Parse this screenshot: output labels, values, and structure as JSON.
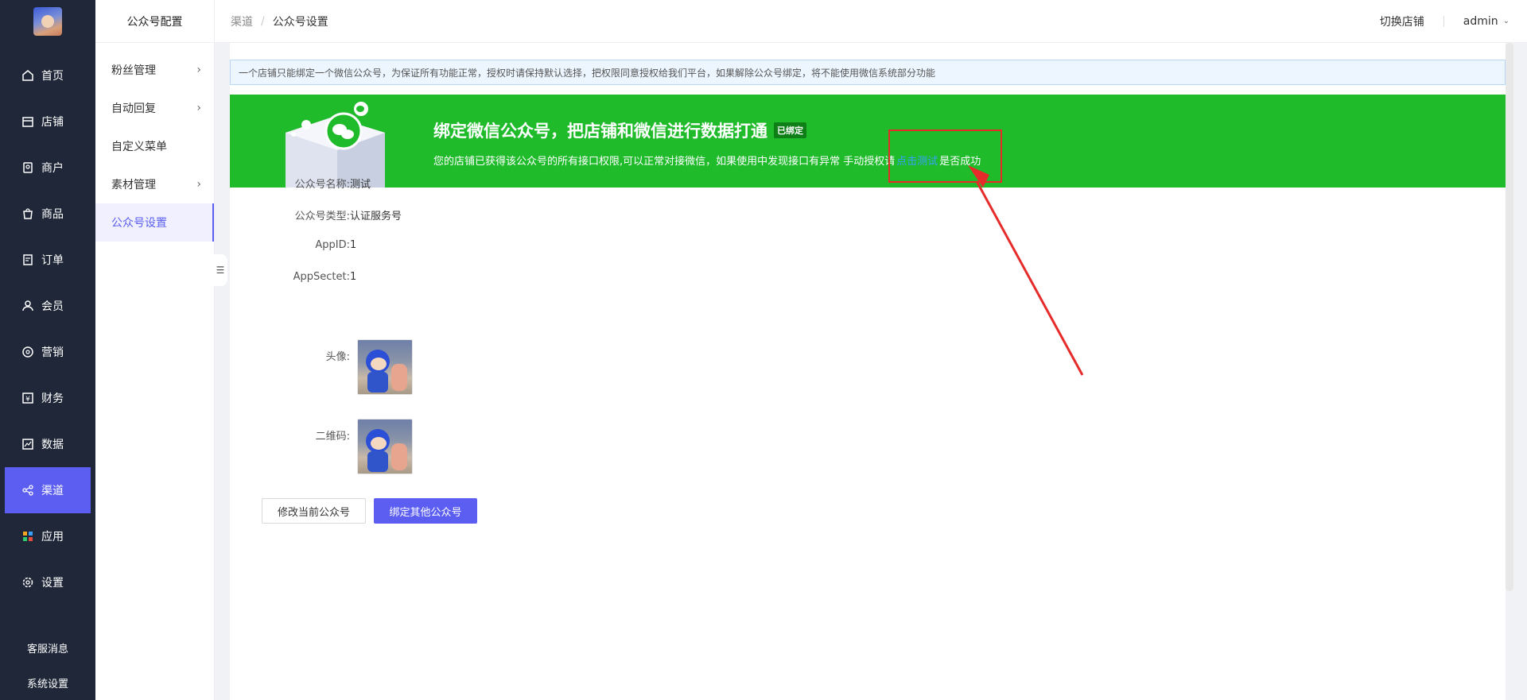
{
  "sidebar": {
    "items": [
      {
        "label": "首页",
        "icon": "home-icon"
      },
      {
        "label": "店铺",
        "icon": "store-icon"
      },
      {
        "label": "商户",
        "icon": "merchant-icon"
      },
      {
        "label": "商品",
        "icon": "bag-icon"
      },
      {
        "label": "订单",
        "icon": "order-icon"
      },
      {
        "label": "会员",
        "icon": "user-icon"
      },
      {
        "label": "营销",
        "icon": "marketing-icon"
      },
      {
        "label": "财务",
        "icon": "yuan-icon"
      },
      {
        "label": "数据",
        "icon": "chart-icon"
      },
      {
        "label": "渠道",
        "icon": "share-icon"
      },
      {
        "label": "应用",
        "icon": "apps-icon"
      },
      {
        "label": "设置",
        "icon": "gear-icon"
      }
    ],
    "active_index": 9,
    "bottom": [
      "客服消息",
      "系统设置"
    ]
  },
  "submenu": {
    "title": "公众号配置",
    "items": [
      {
        "label": "粉丝管理",
        "has_children": true
      },
      {
        "label": "自动回复",
        "has_children": true
      },
      {
        "label": "自定义菜单",
        "has_children": false
      },
      {
        "label": "素材管理",
        "has_children": true
      },
      {
        "label": "公众号设置",
        "has_children": false
      }
    ],
    "active_index": 4
  },
  "header": {
    "breadcrumb_parent": "渠道",
    "breadcrumb_sep": "/",
    "breadcrumb_current": "公众号设置",
    "switch_store": "切换店铺",
    "user": "admin"
  },
  "notice": "一个店铺只能绑定一个微信公众号，为保证所有功能正常，授权时请保持默认选择，把权限同意授权给我们平台，如果解除公众号绑定，将不能使用微信系统部分功能",
  "banner": {
    "title": "绑定微信公众号，把店铺和微信进行数据打通",
    "tag": "已绑定",
    "desc_before": "您的店铺已获得该公众号的所有接口权限,可以正常对接微信，如果使用中发现接口有异常 手动授权请",
    "desc_link": "点击测试",
    "desc_after": "是否成功"
  },
  "info": {
    "name_label": "公众号名称:",
    "name_value": "测试",
    "type_label": "公众号类型:",
    "type_value": "认证服务号",
    "appid_label": "AppID:",
    "appid_value": "1",
    "secret_label": "AppSectet:",
    "secret_value": "1",
    "avatar_label": "头像:",
    "qrcode_label": "二维码:"
  },
  "buttons": {
    "modify": "修改当前公众号",
    "bind_other": "绑定其他公众号"
  },
  "colors": {
    "sidebar_bg": "#1f2738",
    "accent": "#5b5ef1",
    "banner_green": "#1fbb2b",
    "annotation_red": "#e62b2b"
  }
}
